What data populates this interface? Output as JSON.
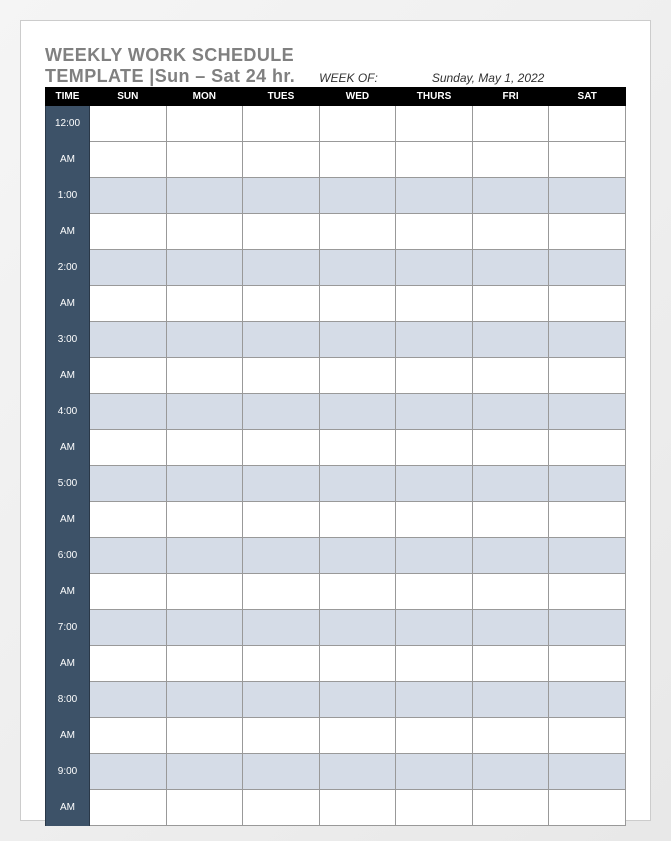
{
  "title": {
    "line1": "WEEKLY WORK SCHEDULE",
    "line2": "TEMPLATE |Sun – Sat 24 hr."
  },
  "weekof": {
    "label": "WEEK OF:",
    "value": "Sunday, May 1, 2022"
  },
  "header": {
    "time": "TIME",
    "days": [
      "SUN",
      "MON",
      "TUES",
      "WED",
      "THURS",
      "FRI",
      "SAT"
    ]
  },
  "times": [
    {
      "t": "12:00",
      "p": "AM"
    },
    {
      "t": "1:00",
      "p": "AM"
    },
    {
      "t": "2:00",
      "p": "AM"
    },
    {
      "t": "3:00",
      "p": "AM"
    },
    {
      "t": "4:00",
      "p": "AM"
    },
    {
      "t": "5:00",
      "p": "AM"
    },
    {
      "t": "6:00",
      "p": "AM"
    },
    {
      "t": "7:00",
      "p": "AM"
    },
    {
      "t": "8:00",
      "p": "AM"
    },
    {
      "t": "9:00",
      "p": "AM"
    }
  ]
}
